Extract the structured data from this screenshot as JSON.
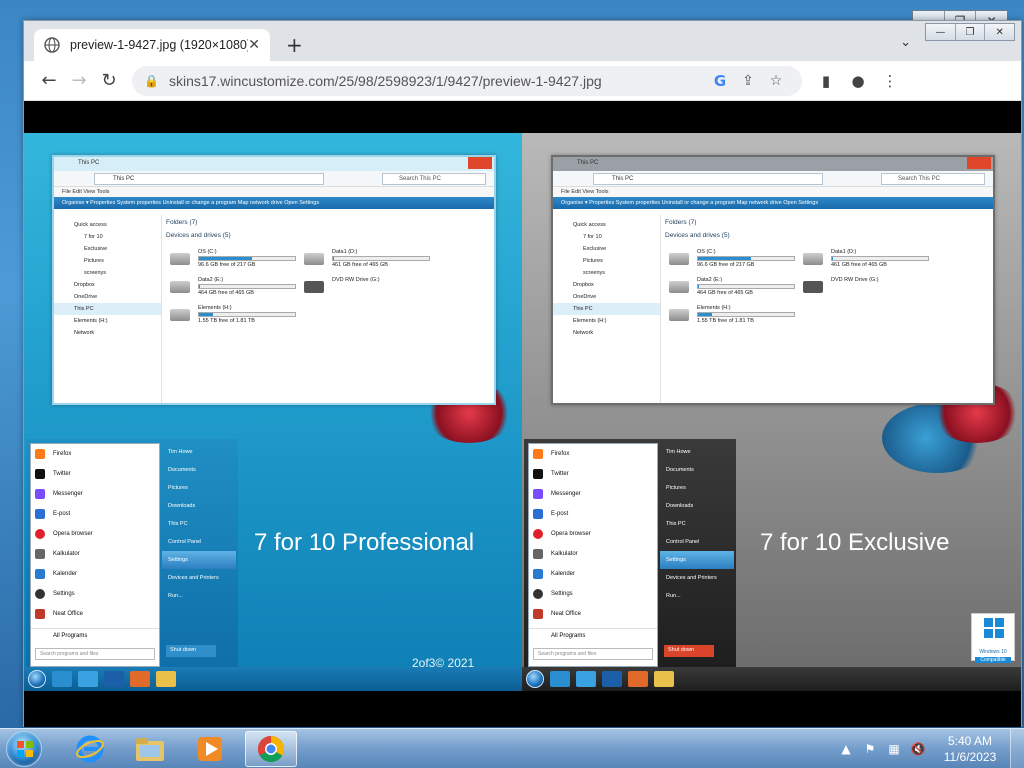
{
  "desktop": {
    "window_controls": [
      "—",
      "❐",
      "✕"
    ]
  },
  "browser": {
    "tab_title": "preview-1-9427.jpg (1920×1080)",
    "tab_close": "✕",
    "new_tab": "+",
    "tab_list": "⌄",
    "window_controls": [
      "—",
      "❐",
      "✕"
    ],
    "back": "←",
    "forward": "→",
    "reload": "↻",
    "url": "skins17.wincustomize.com/25/98/2598923/1/9427/preview-1-9427.jpg",
    "google_lens": "G",
    "share": "⇪",
    "bookmark": "☆",
    "sidepanel": "▮",
    "profile": "●",
    "menu": "⋮"
  },
  "image": {
    "left_caption": "7 for 10 Professional",
    "right_caption": "7 for 10 Exclusive",
    "copyright": "2of3© 2021",
    "badge_line1": "Windows 10",
    "badge_line2": "Compatible",
    "explorer": {
      "title": "This PC",
      "address": "This PC",
      "search": "Search This PC",
      "menu": "File   Edit   View   Tools",
      "commands": "Organise ▾     Properties     System properties     Uninstall or change a program     Map network drive     Open Settings",
      "nav": [
        "Quick access",
        "7 for 10",
        "Exclusive",
        "Pictures",
        "screenys",
        "Dropbox",
        "OneDrive",
        "This PC",
        "Elements (H:)",
        "Network"
      ],
      "folders_heading": "Folders (7)",
      "devices_heading": "Devices and drives (5)",
      "drives": [
        {
          "name": "OS (C:)",
          "free": "96.6 GB free of 217 GB",
          "used": 0.55
        },
        {
          "name": "Data1 (D:)",
          "free": "461 GB free of 465 GB",
          "used": 0.01
        },
        {
          "name": "Data2 (E:)",
          "free": "464 GB free of 465 GB",
          "used": 0.01
        },
        {
          "name": "DVD RW Drive (G:)",
          "free": "",
          "used": 0
        },
        {
          "name": "Elements (H:)",
          "free": "1.55 TB free of 1.81 TB",
          "used": 0.15
        }
      ]
    },
    "startmenu": {
      "left": [
        "Firefox",
        "Twitter",
        "Messenger",
        "E-post",
        "Opera browser",
        "Kalkulator",
        "Kalender",
        "Settings",
        "Neat Office"
      ],
      "all_programs": "All Programs",
      "search": "Search programs and files",
      "right": [
        "Tim Howe",
        "Documents",
        "Pictures",
        "Downloads",
        "This PC",
        "Control Panel",
        "Settings",
        "Devices and Printers",
        "Run..."
      ],
      "shutdown": "Shut down"
    }
  },
  "taskbar": {
    "tray_arrow": "▲",
    "time": "5:40 AM",
    "date": "11/6/2023"
  },
  "colors": {
    "chrome_accent": "#4285f4",
    "taskbar": "#6f9ccb"
  }
}
